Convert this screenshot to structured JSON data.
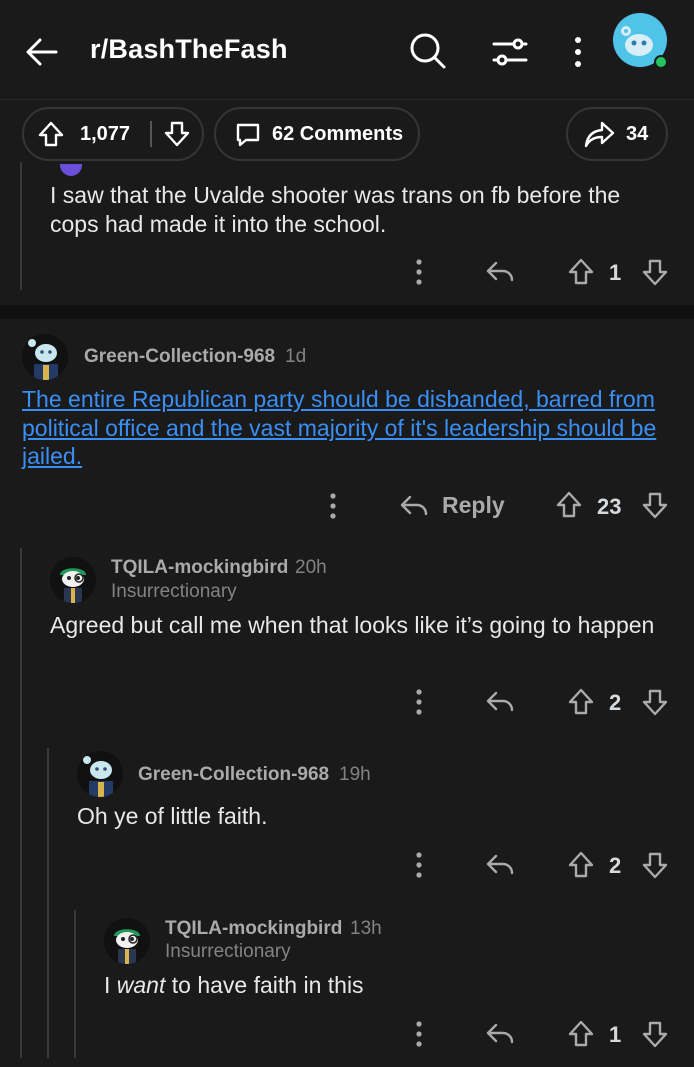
{
  "header": {
    "subreddit": "r/BashTheFash"
  },
  "post_actions": {
    "score": "1,077",
    "comments": "62 Comments",
    "shares": "34"
  },
  "comments": [
    {
      "id": "c0",
      "text": "I saw that the Uvalde shooter was trans on fb before the cops had made it into the school.",
      "score": "1"
    },
    {
      "id": "c1",
      "username": "Green-Collection-968",
      "time": "1d",
      "text": "The entire Republican party should be disbanded, barred from political office and the vast majority of it's leadership should be jailed.",
      "reply_label": "Reply",
      "score": "23"
    },
    {
      "id": "c2",
      "username": "TQILA-mockingbird",
      "time": "20h",
      "flair": "Insurrectionary",
      "text": "Agreed but call me when that looks like it’s going to happen",
      "score": "2"
    },
    {
      "id": "c3",
      "username": "Green-Collection-968",
      "time": "19h",
      "text": "Oh ye of little faith.",
      "score": "2"
    },
    {
      "id": "c4",
      "username": "TQILA-mockingbird",
      "time": "13h",
      "flair": "Insurrectionary",
      "text_prefix": "I",
      "text_emphasis": "want",
      "text_suffix": "to have faith in this",
      "score": "1"
    }
  ],
  "colors": {
    "background": "#1a1a1b",
    "link": "#3a8ff5",
    "avatar_cyan": "#4fc3e8",
    "online_dot": "#22c55e"
  }
}
